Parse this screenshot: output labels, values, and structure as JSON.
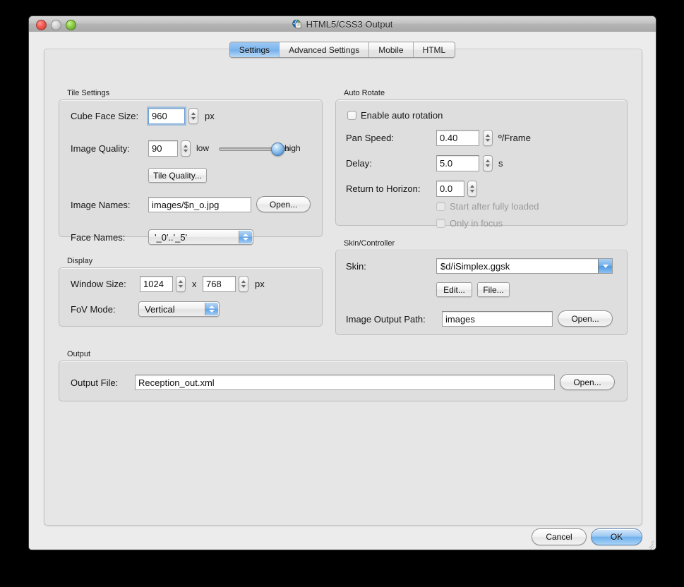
{
  "window": {
    "title": "HTML5/CSS3 Output",
    "app_icon": "globe-document-icon",
    "traffic_lights": [
      "close",
      "minimize",
      "zoom"
    ]
  },
  "tabs": [
    {
      "label": "Settings",
      "active": true
    },
    {
      "label": "Advanced Settings",
      "active": false
    },
    {
      "label": "Mobile",
      "active": false
    },
    {
      "label": "HTML",
      "active": false
    }
  ],
  "tile_settings": {
    "group_label": "Tile Settings",
    "cube_face_size": {
      "label": "Cube Face Size:",
      "value": "960",
      "unit": "px",
      "focused": true
    },
    "image_quality": {
      "label": "Image Quality:",
      "value": "90",
      "slider_low": "low",
      "slider_high": "high",
      "slider_percent": 90
    },
    "tile_quality_button": "Tile Quality...",
    "image_names": {
      "label": "Image Names:",
      "value": "images/$n_o.jpg",
      "button": "Open..."
    },
    "face_names": {
      "label": "Face Names:",
      "value": "'_0'..'_5'"
    }
  },
  "display": {
    "group_label": "Display",
    "window_size": {
      "label": "Window Size:",
      "width": "1024",
      "separator": "x",
      "height": "768",
      "unit": "px"
    },
    "fov_mode": {
      "label": "FoV Mode:",
      "value": "Vertical"
    }
  },
  "auto_rotate": {
    "group_label": "Auto Rotate",
    "enable": {
      "label": "Enable auto rotation",
      "checked": false
    },
    "pan_speed": {
      "label": "Pan Speed:",
      "value": "0.40",
      "unit": "º/Frame"
    },
    "delay": {
      "label": "Delay:",
      "value": "5.0",
      "unit": "s"
    },
    "return_to_horizon": {
      "label": "Return to Horizon:",
      "value": "0.0"
    },
    "start_after_loaded": {
      "label": "Start after fully loaded",
      "checked": false,
      "disabled": true
    },
    "only_in_focus": {
      "label": "Only in focus",
      "checked": false,
      "disabled": true
    }
  },
  "skin_controller": {
    "group_label": "Skin/Controller",
    "skin": {
      "label": "Skin:",
      "value": "$d/iSimplex.ggsk"
    },
    "edit_button": "Edit...",
    "file_button": "File...",
    "image_output_path": {
      "label": "Image Output Path:",
      "value": "images",
      "button": "Open..."
    }
  },
  "output": {
    "group_label": "Output",
    "output_file": {
      "label": "Output File:",
      "value": "Reception_out.xml",
      "button": "Open..."
    }
  },
  "footer": {
    "cancel": "Cancel",
    "ok": "OK"
  },
  "colors": {
    "accent_blue": "#7eb6ee",
    "window_bg": "#ececec",
    "panel_bg": "#e6e6e6",
    "group_bg": "#dedede"
  }
}
